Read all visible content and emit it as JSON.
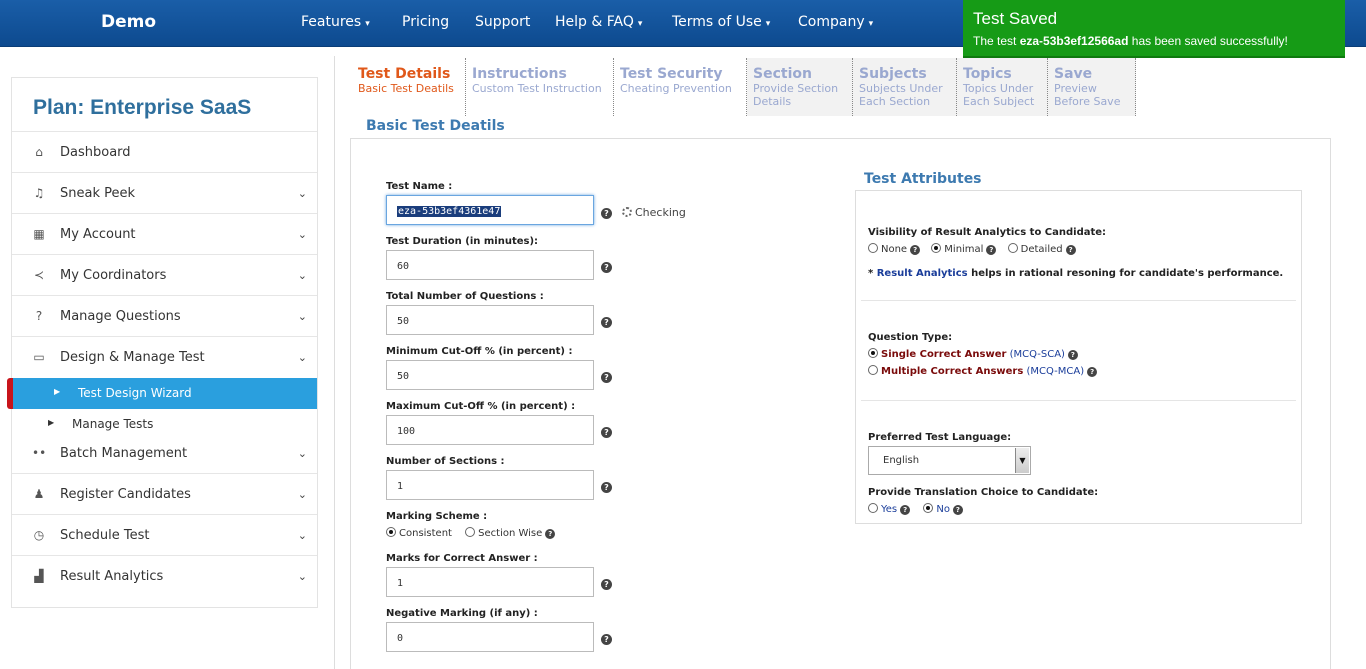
{
  "nav": {
    "brand": "Demo",
    "items": [
      {
        "label": "Features",
        "dropdown": true
      },
      {
        "label": "Pricing",
        "dropdown": false
      },
      {
        "label": "Support",
        "dropdown": false
      },
      {
        "label": "Help & FAQ",
        "dropdown": true
      },
      {
        "label": "Terms of Use",
        "dropdown": true
      },
      {
        "label": "Company",
        "dropdown": true
      }
    ]
  },
  "toast": {
    "title": "Test Saved",
    "msg_prefix": "The test ",
    "msg_test": "eza-53b3ef12566ad",
    "msg_suffix": " has been saved successfully!"
  },
  "sidebar": {
    "plan": "Plan: Enterprise SaaS",
    "items": [
      {
        "label": "Dashboard"
      },
      {
        "label": "Sneak Peek"
      },
      {
        "label": "My Account"
      },
      {
        "label": "My Coordinators"
      },
      {
        "label": "Manage Questions"
      },
      {
        "label": "Design & Manage Test"
      },
      {
        "label": "Batch Management"
      },
      {
        "label": "Register Candidates"
      },
      {
        "label": "Schedule Test"
      },
      {
        "label": "Result Analytics"
      }
    ],
    "sub": [
      {
        "label": "Test Design Wizard"
      },
      {
        "label": "Manage Tests"
      }
    ]
  },
  "tabs": [
    {
      "title": "Test Details",
      "sub1": "Basic Test Deatils",
      "sub2": ""
    },
    {
      "title": "Instructions",
      "sub1": "Custom Test Instruction",
      "sub2": ""
    },
    {
      "title": "Test Security",
      "sub1": "Cheating Prevention",
      "sub2": ""
    },
    {
      "title": "Section",
      "sub1": "Provide Section",
      "sub2": "Details"
    },
    {
      "title": "Subjects",
      "sub1": "Subjects Under",
      "sub2": "Each Section"
    },
    {
      "title": "Topics",
      "sub1": "Topics Under",
      "sub2": "Each Subject"
    },
    {
      "title": "Save",
      "sub1": "Preview",
      "sub2": "Before Save"
    }
  ],
  "form": {
    "section_title": "Basic Test Deatils",
    "test_name_label": "Test Name :",
    "test_name_value": "eza-53b3ef4361e47",
    "checking": "Checking",
    "duration_label": "Test Duration (in minutes):",
    "duration_value": "60",
    "total_q_label": "Total Number of Questions :",
    "total_q_value": "50",
    "min_cutoff_label": "Minimum Cut-Off % (in percent) :",
    "min_cutoff_value": "50",
    "max_cutoff_label": "Maximum Cut-Off % (in percent) :",
    "max_cutoff_value": "100",
    "sections_label": "Number of Sections :",
    "sections_value": "1",
    "marking_label": "Marking Scheme :",
    "marking_opt1": "Consistent",
    "marking_opt2": "Section Wise",
    "correct_label": "Marks for Correct Answer :",
    "correct_value": "1",
    "negative_label": "Negative Marking (if any) :",
    "negative_value": "0",
    "help_glyph": "?"
  },
  "attributes": {
    "title": "Test Attributes",
    "visibility_label": "Visibility of Result Analytics to Candidate:",
    "vis_none": "None",
    "vis_minimal": "Minimal",
    "vis_detailed": "Detailed",
    "note_star": "* ",
    "note_link": "Result Analytics",
    "note_rest": " helps in rational resoning for candidate's performance.",
    "qtype_label": "Question Type:",
    "qtype_single": "Single Correct Answer",
    "qtype_single_code": "(MCQ-SCA)",
    "qtype_multi": "Multiple Correct Answers",
    "qtype_multi_code": "(MCQ-MCA)",
    "lang_label": "Preferred Test Language:",
    "lang_value": "English",
    "translation_label": "Provide Translation Choice to Candidate:",
    "trans_yes": "Yes",
    "trans_no": "No"
  }
}
